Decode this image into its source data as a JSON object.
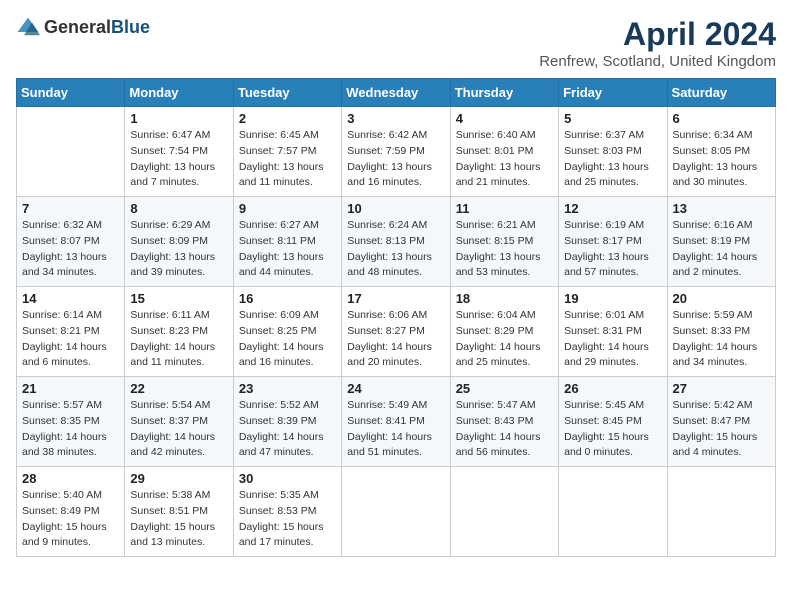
{
  "header": {
    "logo_general": "General",
    "logo_blue": "Blue",
    "month_title": "April 2024",
    "location": "Renfrew, Scotland, United Kingdom"
  },
  "days_of_week": [
    "Sunday",
    "Monday",
    "Tuesday",
    "Wednesday",
    "Thursday",
    "Friday",
    "Saturday"
  ],
  "weeks": [
    [
      {
        "day": "",
        "sunrise": "",
        "sunset": "",
        "daylight": ""
      },
      {
        "day": "1",
        "sunrise": "Sunrise: 6:47 AM",
        "sunset": "Sunset: 7:54 PM",
        "daylight": "Daylight: 13 hours and 7 minutes."
      },
      {
        "day": "2",
        "sunrise": "Sunrise: 6:45 AM",
        "sunset": "Sunset: 7:57 PM",
        "daylight": "Daylight: 13 hours and 11 minutes."
      },
      {
        "day": "3",
        "sunrise": "Sunrise: 6:42 AM",
        "sunset": "Sunset: 7:59 PM",
        "daylight": "Daylight: 13 hours and 16 minutes."
      },
      {
        "day": "4",
        "sunrise": "Sunrise: 6:40 AM",
        "sunset": "Sunset: 8:01 PM",
        "daylight": "Daylight: 13 hours and 21 minutes."
      },
      {
        "day": "5",
        "sunrise": "Sunrise: 6:37 AM",
        "sunset": "Sunset: 8:03 PM",
        "daylight": "Daylight: 13 hours and 25 minutes."
      },
      {
        "day": "6",
        "sunrise": "Sunrise: 6:34 AM",
        "sunset": "Sunset: 8:05 PM",
        "daylight": "Daylight: 13 hours and 30 minutes."
      }
    ],
    [
      {
        "day": "7",
        "sunrise": "Sunrise: 6:32 AM",
        "sunset": "Sunset: 8:07 PM",
        "daylight": "Daylight: 13 hours and 34 minutes."
      },
      {
        "day": "8",
        "sunrise": "Sunrise: 6:29 AM",
        "sunset": "Sunset: 8:09 PM",
        "daylight": "Daylight: 13 hours and 39 minutes."
      },
      {
        "day": "9",
        "sunrise": "Sunrise: 6:27 AM",
        "sunset": "Sunset: 8:11 PM",
        "daylight": "Daylight: 13 hours and 44 minutes."
      },
      {
        "day": "10",
        "sunrise": "Sunrise: 6:24 AM",
        "sunset": "Sunset: 8:13 PM",
        "daylight": "Daylight: 13 hours and 48 minutes."
      },
      {
        "day": "11",
        "sunrise": "Sunrise: 6:21 AM",
        "sunset": "Sunset: 8:15 PM",
        "daylight": "Daylight: 13 hours and 53 minutes."
      },
      {
        "day": "12",
        "sunrise": "Sunrise: 6:19 AM",
        "sunset": "Sunset: 8:17 PM",
        "daylight": "Daylight: 13 hours and 57 minutes."
      },
      {
        "day": "13",
        "sunrise": "Sunrise: 6:16 AM",
        "sunset": "Sunset: 8:19 PM",
        "daylight": "Daylight: 14 hours and 2 minutes."
      }
    ],
    [
      {
        "day": "14",
        "sunrise": "Sunrise: 6:14 AM",
        "sunset": "Sunset: 8:21 PM",
        "daylight": "Daylight: 14 hours and 6 minutes."
      },
      {
        "day": "15",
        "sunrise": "Sunrise: 6:11 AM",
        "sunset": "Sunset: 8:23 PM",
        "daylight": "Daylight: 14 hours and 11 minutes."
      },
      {
        "day": "16",
        "sunrise": "Sunrise: 6:09 AM",
        "sunset": "Sunset: 8:25 PM",
        "daylight": "Daylight: 14 hours and 16 minutes."
      },
      {
        "day": "17",
        "sunrise": "Sunrise: 6:06 AM",
        "sunset": "Sunset: 8:27 PM",
        "daylight": "Daylight: 14 hours and 20 minutes."
      },
      {
        "day": "18",
        "sunrise": "Sunrise: 6:04 AM",
        "sunset": "Sunset: 8:29 PM",
        "daylight": "Daylight: 14 hours and 25 minutes."
      },
      {
        "day": "19",
        "sunrise": "Sunrise: 6:01 AM",
        "sunset": "Sunset: 8:31 PM",
        "daylight": "Daylight: 14 hours and 29 minutes."
      },
      {
        "day": "20",
        "sunrise": "Sunrise: 5:59 AM",
        "sunset": "Sunset: 8:33 PM",
        "daylight": "Daylight: 14 hours and 34 minutes."
      }
    ],
    [
      {
        "day": "21",
        "sunrise": "Sunrise: 5:57 AM",
        "sunset": "Sunset: 8:35 PM",
        "daylight": "Daylight: 14 hours and 38 minutes."
      },
      {
        "day": "22",
        "sunrise": "Sunrise: 5:54 AM",
        "sunset": "Sunset: 8:37 PM",
        "daylight": "Daylight: 14 hours and 42 minutes."
      },
      {
        "day": "23",
        "sunrise": "Sunrise: 5:52 AM",
        "sunset": "Sunset: 8:39 PM",
        "daylight": "Daylight: 14 hours and 47 minutes."
      },
      {
        "day": "24",
        "sunrise": "Sunrise: 5:49 AM",
        "sunset": "Sunset: 8:41 PM",
        "daylight": "Daylight: 14 hours and 51 minutes."
      },
      {
        "day": "25",
        "sunrise": "Sunrise: 5:47 AM",
        "sunset": "Sunset: 8:43 PM",
        "daylight": "Daylight: 14 hours and 56 minutes."
      },
      {
        "day": "26",
        "sunrise": "Sunrise: 5:45 AM",
        "sunset": "Sunset: 8:45 PM",
        "daylight": "Daylight: 15 hours and 0 minutes."
      },
      {
        "day": "27",
        "sunrise": "Sunrise: 5:42 AM",
        "sunset": "Sunset: 8:47 PM",
        "daylight": "Daylight: 15 hours and 4 minutes."
      }
    ],
    [
      {
        "day": "28",
        "sunrise": "Sunrise: 5:40 AM",
        "sunset": "Sunset: 8:49 PM",
        "daylight": "Daylight: 15 hours and 9 minutes."
      },
      {
        "day": "29",
        "sunrise": "Sunrise: 5:38 AM",
        "sunset": "Sunset: 8:51 PM",
        "daylight": "Daylight: 15 hours and 13 minutes."
      },
      {
        "day": "30",
        "sunrise": "Sunrise: 5:35 AM",
        "sunset": "Sunset: 8:53 PM",
        "daylight": "Daylight: 15 hours and 17 minutes."
      },
      {
        "day": "",
        "sunrise": "",
        "sunset": "",
        "daylight": ""
      },
      {
        "day": "",
        "sunrise": "",
        "sunset": "",
        "daylight": ""
      },
      {
        "day": "",
        "sunrise": "",
        "sunset": "",
        "daylight": ""
      },
      {
        "day": "",
        "sunrise": "",
        "sunset": "",
        "daylight": ""
      }
    ]
  ]
}
